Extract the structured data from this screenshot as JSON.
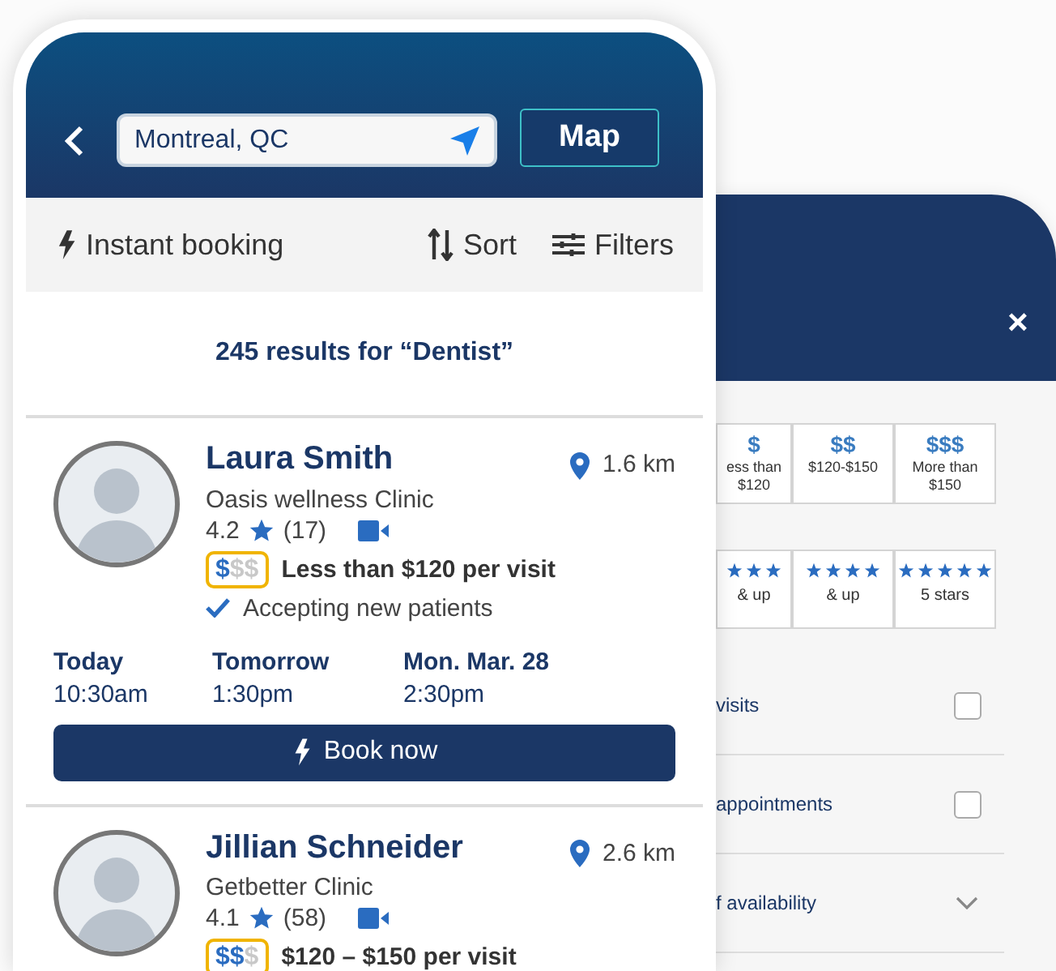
{
  "search": {
    "value": "Montreal, QC"
  },
  "map_button": "Map",
  "toolbar": [
    {
      "kind": "instant",
      "label": "Instant booking"
    },
    {
      "kind": "sort",
      "label": "Sort"
    },
    {
      "kind": "filters",
      "label": "Filters"
    }
  ],
  "results_heading": "245 results for “Dentist”",
  "providers": [
    {
      "name": "Laura Smith",
      "clinic": "Oasis wellness Clinic",
      "distance": "1.6 km",
      "rating": "4.2",
      "reviews": "(17)",
      "video": true,
      "price_filled": "$",
      "price_unfilled": "$$",
      "price_text": "Less than $120 per visit",
      "accepting": "Accepting new patients",
      "slots": [
        {
          "day": "Today",
          "time": "10:30am"
        },
        {
          "day": "Tomorrow",
          "time": "1:30pm"
        },
        {
          "day": "Mon. Mar. 28",
          "time": "2:30pm"
        }
      ],
      "book": "Book now"
    },
    {
      "name": "Jillian Schneider",
      "clinic": "Getbetter Clinic",
      "distance": "2.6 km",
      "rating": "4.1",
      "reviews": "(58)",
      "video": true,
      "price_filled": "$$",
      "price_unfilled": "$",
      "price_text": "$120 – $150 per visit"
    }
  ],
  "filter_panel": {
    "close": "×",
    "price_options": [
      {
        "symbol": "$",
        "label": "ess than $120"
      },
      {
        "symbol": "$$",
        "label": "$120-$150"
      },
      {
        "symbol": "$$$",
        "label": "More than $150"
      }
    ],
    "rating_options": [
      {
        "stars": 3,
        "label": "& up"
      },
      {
        "stars": 4,
        "label": "& up"
      },
      {
        "stars": 5,
        "label": "5 stars"
      }
    ],
    "rows": [
      {
        "kind": "checkbox",
        "label": "visits",
        "checked": false
      },
      {
        "kind": "checkbox",
        "label": "appointments",
        "checked": false
      },
      {
        "kind": "dropdown",
        "label": "f availability",
        "expanded": false
      }
    ]
  }
}
